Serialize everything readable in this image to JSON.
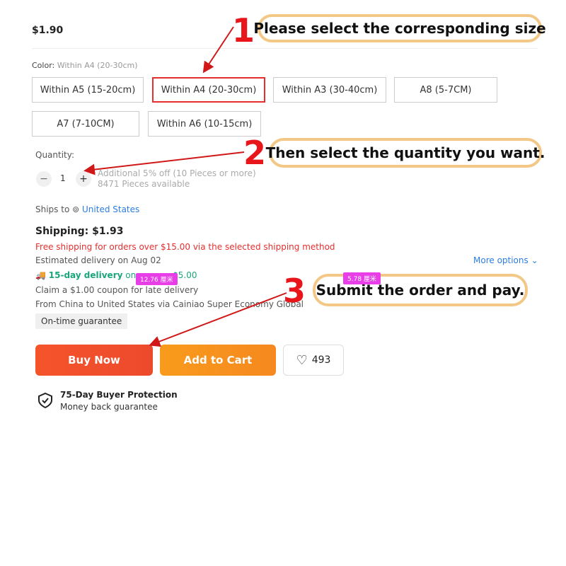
{
  "price": "$1.90",
  "color": {
    "label": "Color:",
    "selected": "Within A4 (20-30cm)"
  },
  "sizes": [
    "Within A5 (15-20cm)",
    "Within A4 (20-30cm)",
    "Within A3 (30-40cm)",
    "A8 (5-7CM)",
    "A7 (7-10CM)",
    "Within A6 (10-15cm)"
  ],
  "quantity": {
    "label": "Quantity:",
    "minus": "−",
    "value": "1",
    "plus": "+",
    "discount": "Additional 5% off (10 Pieces or more)",
    "available": "8471 Pieces available"
  },
  "ships": {
    "label": "Ships to",
    "country": "United States"
  },
  "shipping": {
    "title": "Shipping: $1.93",
    "free": "Free shipping for orders over $15.00 via the selected shipping method",
    "estimated": "Estimated delivery on Aug 02",
    "more": "More options",
    "delivery_bold": "15-day delivery",
    "delivery_rest": "on or",
    "delivery_amount": "$5.00",
    "coupon": "Claim a $1.00 coupon for late delivery",
    "route": "From China to United States via Cainiao Super Economy Global",
    "guarantee": "On-time guarantee"
  },
  "buttons": {
    "buy": "Buy Now",
    "cart": "Add to Cart",
    "wishlist_count": "493"
  },
  "protection": {
    "title": "75-Day Buyer Protection",
    "subtitle": "Money back guarantee"
  },
  "callouts": [
    {
      "num": "1",
      "text": "Please select the corresponding size"
    },
    {
      "num": "2",
      "text": "Then select the quantity you want."
    },
    {
      "num": "3",
      "text": "Submit the order and pay."
    }
  ],
  "measure_tags": [
    "12.76 厘米",
    "5.78 厘米"
  ],
  "colors": {
    "selected_border": "#e62e2e",
    "buy": "#f0502a",
    "cart": "#f7931e",
    "link": "#2b7de1",
    "green": "#1aa57a",
    "red": "#e8161b",
    "callout_border": "#f3c887"
  }
}
